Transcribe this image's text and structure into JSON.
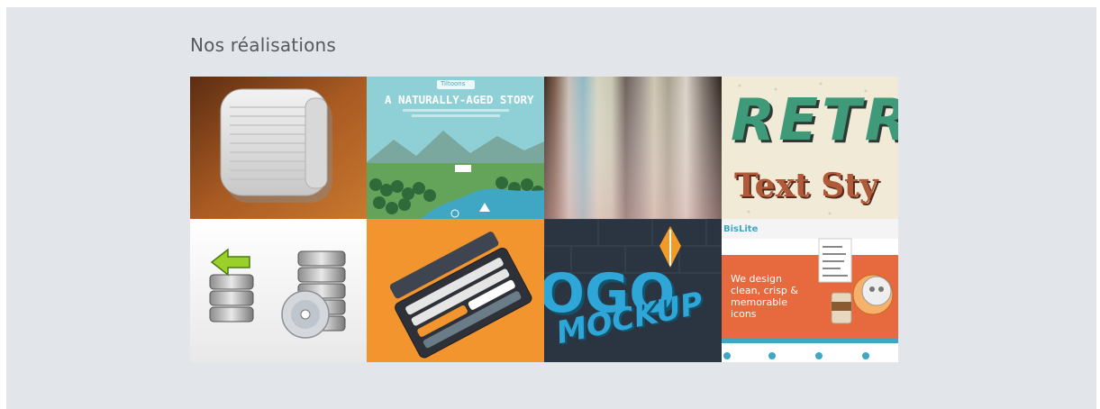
{
  "section": {
    "title": "Nos réalisations"
  },
  "tiles": [
    {
      "name": "notes-app-icon"
    },
    {
      "name": "naturally-aged-story",
      "badge": "Tiltoons",
      "headline": "A NATURALLY-AGED STORY"
    },
    {
      "name": "blurred-gradient-stripes"
    },
    {
      "name": "retro-text-style",
      "line1": "RETR",
      "line2": "Text Sty"
    },
    {
      "name": "database-backup-icon"
    },
    {
      "name": "mobile-ui-kit"
    },
    {
      "name": "logo-mockup",
      "line1": "OGO",
      "line2": "MOCKUP"
    },
    {
      "name": "bislite-theme",
      "logo": "BisLite",
      "tagline_lines": [
        "We design",
        "clean, crisp &",
        "memorable",
        "icons"
      ]
    }
  ]
}
